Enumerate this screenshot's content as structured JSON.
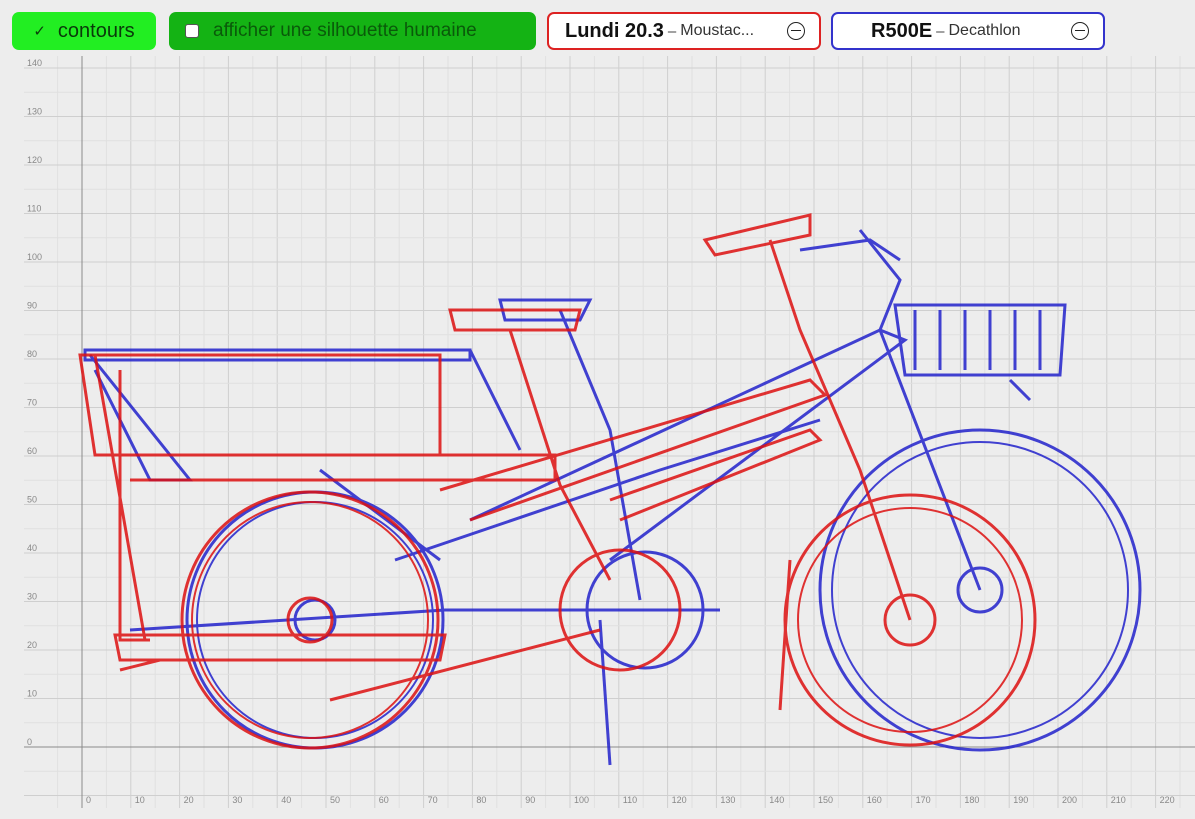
{
  "toolbar": {
    "contours_label": "contours",
    "contours_icon": "checkmark-icon",
    "silhouette_label": "afficher une silhouette humaine",
    "bikes": [
      {
        "model": "Lundi 20.3",
        "brand": "Moustac...",
        "color": "#dd1111"
      },
      {
        "model": "R500E",
        "brand": "Decathlon",
        "color": "#2222cc"
      }
    ]
  },
  "grid": {
    "x_ticks": [
      "0",
      "10",
      "20",
      "30",
      "40",
      "50",
      "60",
      "70",
      "80",
      "90",
      "100",
      "110",
      "120",
      "130",
      "140",
      "150",
      "160",
      "170",
      "180",
      "190",
      "200",
      "210",
      "220"
    ],
    "y_ticks": [
      "0",
      "10",
      "20",
      "30",
      "40",
      "50",
      "60",
      "70",
      "80",
      "90",
      "100",
      "110",
      "120",
      "130",
      "140"
    ]
  },
  "colors": {
    "green_active": "#22ee22",
    "green_dark": "#14b314",
    "red": "#dd1111",
    "blue": "#2222cc"
  }
}
